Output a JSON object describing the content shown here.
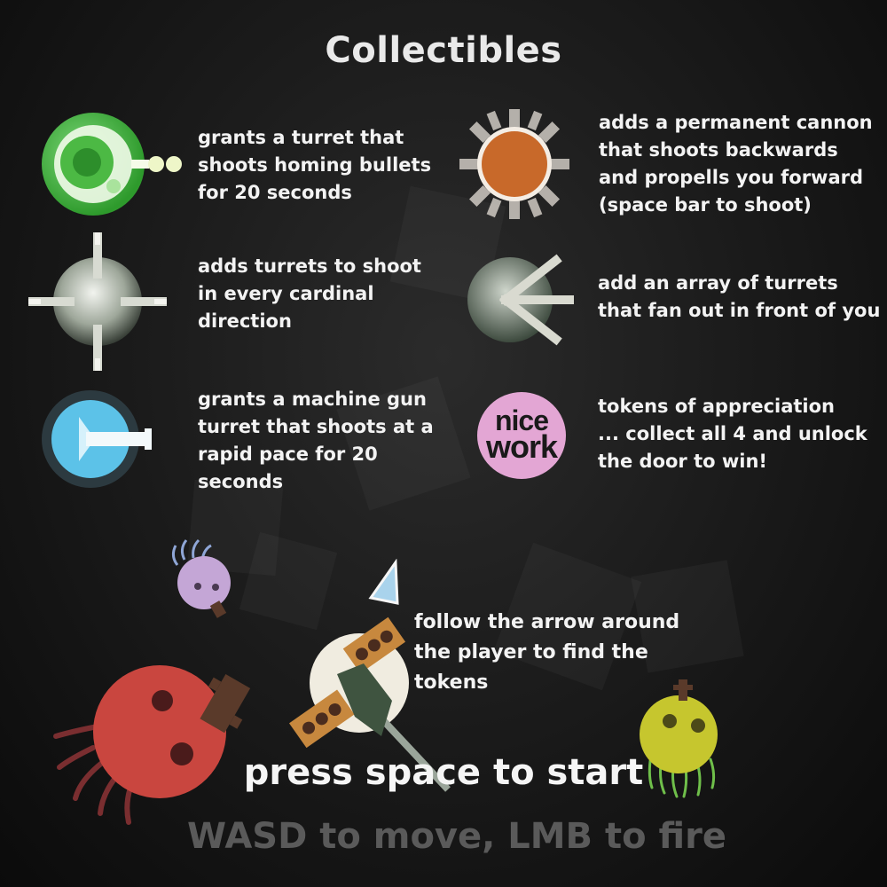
{
  "title": "Collectibles",
  "collectibles": [
    {
      "icon": "homing-turret-icon",
      "text": "grants a turret that\nshoots homing bullets\nfor 20 seconds"
    },
    {
      "icon": "back-cannon-icon",
      "text": "adds a permanent cannon\nthat shoots backwards\nand propells you forward\n(space bar to shoot)"
    },
    {
      "icon": "cardinal-turrets-icon",
      "text": "adds turrets to shoot\nin every cardinal\ndirection"
    },
    {
      "icon": "fan-turrets-icon",
      "text": "add an array of turrets\nthat fan out in front of you"
    },
    {
      "icon": "machine-gun-icon",
      "text": "grants a machine gun\nturret that shoots at a\nrapid pace for 20\nseconds"
    },
    {
      "icon": "nice-work-token-icon",
      "text": "tokens of appreciation\n... collect all 4 and unlock\nthe door to win!",
      "token_label": [
        "nice",
        "work"
      ]
    }
  ],
  "arrow_hint": "follow the arrow around\nthe player to find the\ntokens",
  "start_prompt": "press space to start",
  "controls": "WASD to move, LMB to fire",
  "colors": {
    "homing": "#3fae3a",
    "cannon": "#c8692a",
    "machine_gun": "#5cc2e8",
    "token": "#e3a6d4",
    "red_enemy": "#c9463f",
    "purple_enemy": "#c4a6d6",
    "yellow_enemy": "#c6c62e",
    "player_body": "#f0ece0",
    "player_gun": "#3f5440"
  }
}
